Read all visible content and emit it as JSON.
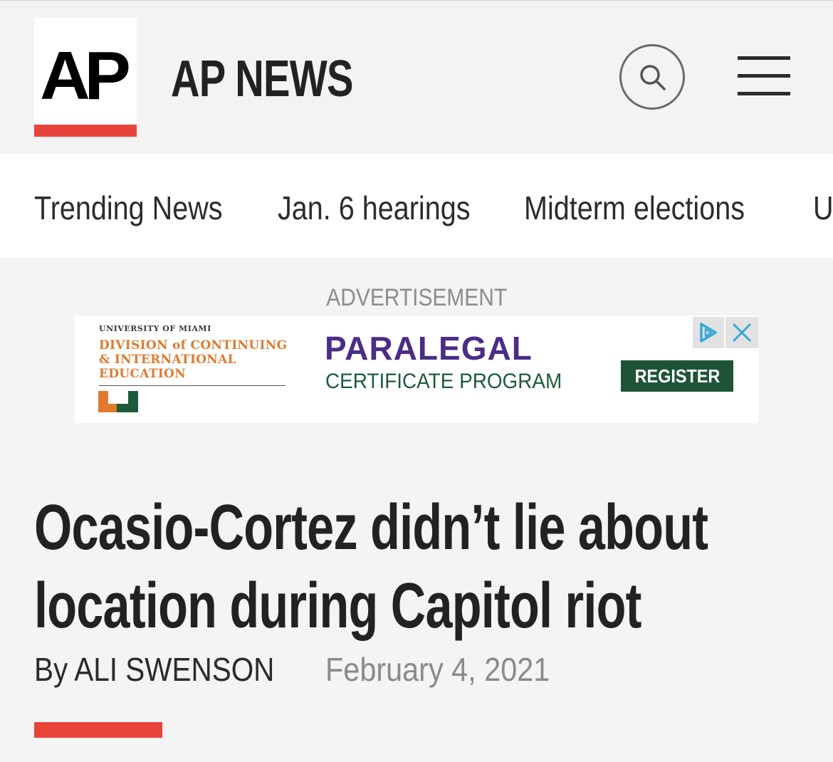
{
  "header": {
    "logo_text": "AP",
    "brand_title": "AP NEWS",
    "search_icon": "search-icon",
    "menu_icon": "hamburger-menu-icon",
    "accent_color": "#e8433b"
  },
  "nav": {
    "items": [
      {
        "label": "Trending News"
      },
      {
        "label": "Jan. 6 hearings"
      },
      {
        "label": "Midterm elections"
      },
      {
        "label": "U"
      }
    ]
  },
  "ad": {
    "label": "ADVERTISEMENT",
    "sponsor_small": "UNIVERSITY OF MIAMI",
    "sponsor_division_l1": "DIVISION of CONTINUING",
    "sponsor_division_l2": "& INTERNATIONAL",
    "sponsor_division_l3": "EDUCATION",
    "headline": "PARALEGAL",
    "subheadline": "CERTIFICATE PROGRAM",
    "cta": "REGISTER",
    "adchoices_icon": "adchoices-icon",
    "close_icon": "close-icon"
  },
  "article": {
    "headline_line1": "Ocasio-Cortez didn’t lie about",
    "headline_line2": "location during Capitol riot",
    "byline": "By ALI SWENSON",
    "date": "February 4, 2021"
  }
}
